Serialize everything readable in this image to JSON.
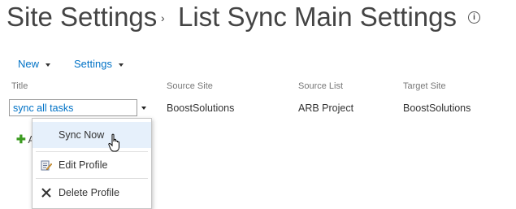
{
  "title": {
    "site": "Site Settings",
    "separator": "›",
    "page": "List Sync Main Settings",
    "info": "i"
  },
  "toolbar": {
    "new_label": "New",
    "settings_label": "Settings"
  },
  "columns": {
    "title": "Title",
    "source_site": "Source Site",
    "source_list": "Source List",
    "target_site": "Target Site"
  },
  "row": {
    "profile": "sync all tasks",
    "source_site": "BoostSolutions",
    "source_list": "ARB Project",
    "target_site": "BoostSolutions"
  },
  "add": {
    "label": "A"
  },
  "menu": {
    "sync_now": "Sync Now",
    "edit_profile": "Edit Profile",
    "delete_profile": "Delete Profile"
  }
}
